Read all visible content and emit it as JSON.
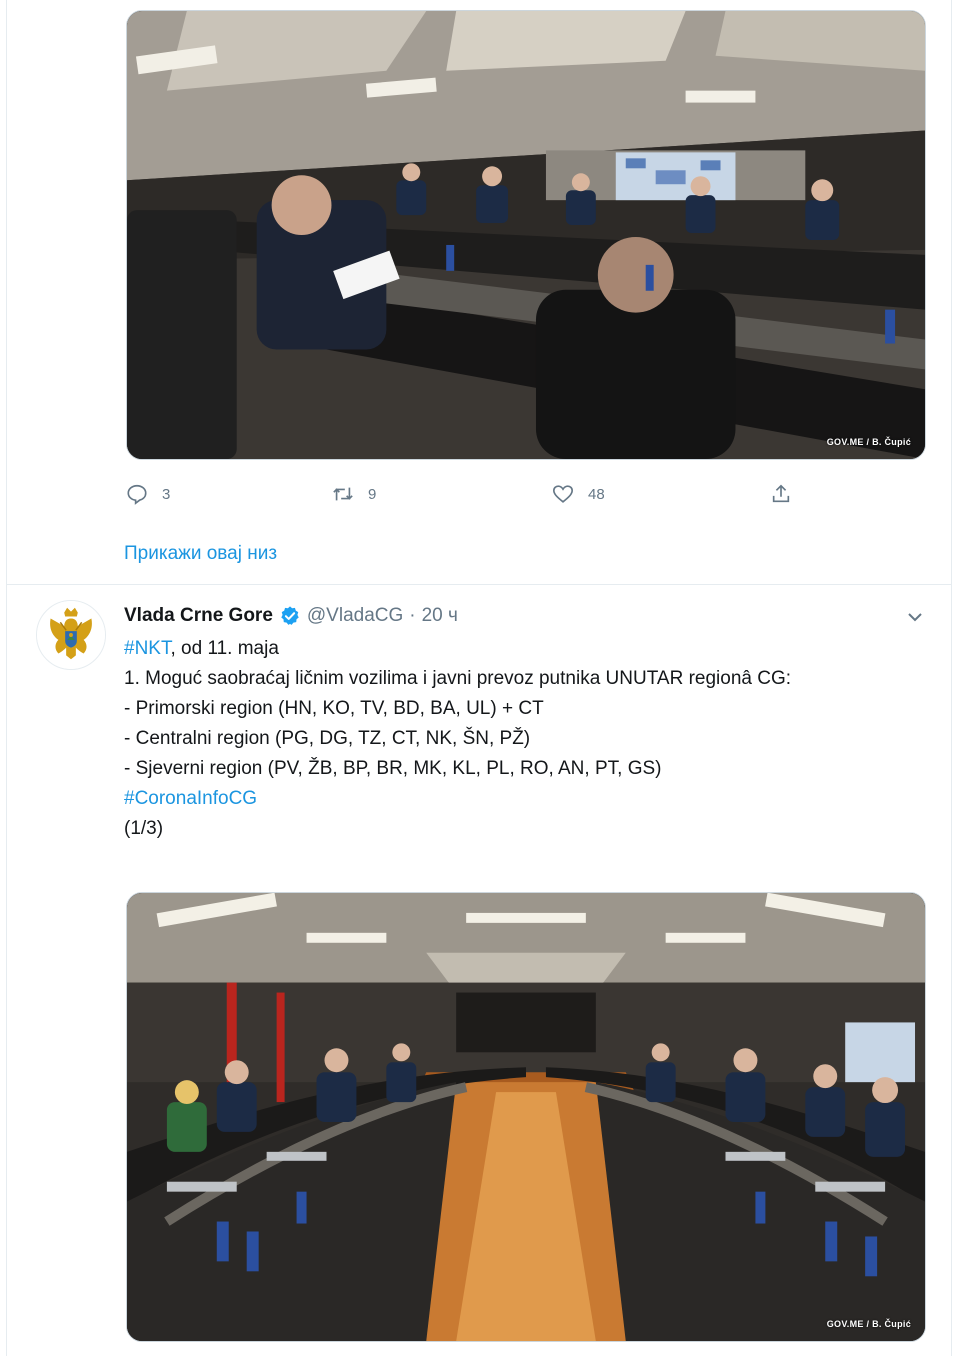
{
  "tweet1": {
    "image_alt": "Government session meeting room photo",
    "image_credit": "GOV.ME / B. Čupić",
    "actions": {
      "reply_count": "3",
      "retweet_count": "9",
      "like_count": "48"
    },
    "show_thread": "Прикажи овај низ"
  },
  "tweet2": {
    "author_name": "Vlada Crne Gore",
    "author_handle": "@VladaCG",
    "separator": "·",
    "time": "20 ч",
    "lines": {
      "l1_hashtag": "#NKT",
      "l1_text": ", od 11. maja",
      "l2": "1. Moguć saobraćaj ličnim vozilima i javni prevoz putnika UNUTAR regionâ CG:",
      "l3": "- Primorski region (HN, KO, TV, BD, BA, UL) + CT",
      "l4": "- Centralni region (PG, DG, TZ, CT, NK, ŠN, PŽ)",
      "l5": "- Sjeverni region (PV, ŽB, BP, BR, MK, KL, PL, RO, AN, PT, GS)",
      "l6_hashtag": "#CoronaInfoCG",
      "l7": "(1/3)"
    },
    "image_credit": "GOV.ME / B. Čupić"
  },
  "colors": {
    "link": "#1b95e0",
    "muted": "#657786",
    "text": "#14171a",
    "border": "#e6ecf0"
  },
  "icons": {
    "reply": "reply-icon",
    "retweet": "retweet-icon",
    "like": "heart-icon",
    "share": "share-icon",
    "verified": "verified-badge-icon",
    "caret": "chevron-down-icon"
  }
}
